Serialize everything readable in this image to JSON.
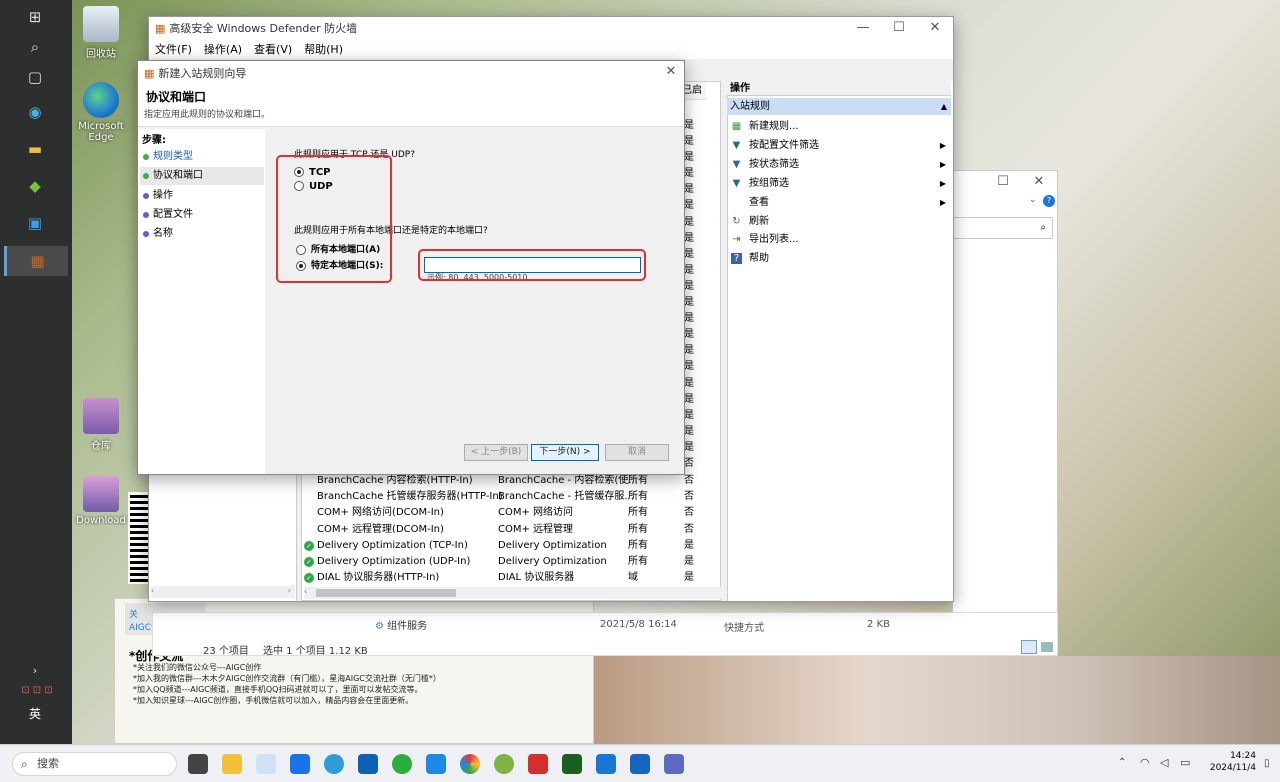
{
  "desktop": {
    "icons": [
      {
        "label": "回收站"
      },
      {
        "label": "Microsoft Edge"
      },
      {
        "label": "仓库"
      },
      {
        "label": "Download"
      }
    ]
  },
  "firewall": {
    "title": "高级安全 Windows Defender 防火墙",
    "menu": [
      "文件(F)",
      "操作(A)",
      "查看(V)",
      "帮助(H)"
    ],
    "col_partial": "已启用",
    "rows": [
      {
        "name": "BranchCache 内容检索(HTTP-In)",
        "group": "BranchCache - 内容检索(使...",
        "profile": "所有",
        "enabled": "否",
        "ok": false
      },
      {
        "name": "BranchCache 托管缓存服务器(HTTP-In)",
        "group": "BranchCache - 托管缓存服...",
        "profile": "所有",
        "enabled": "否",
        "ok": false
      },
      {
        "name": "COM+ 网络访问(DCOM-In)",
        "group": "COM+ 网络访问",
        "profile": "所有",
        "enabled": "否",
        "ok": false
      },
      {
        "name": "COM+ 远程管理(DCOM-In)",
        "group": "COM+ 远程管理",
        "profile": "所有",
        "enabled": "否",
        "ok": false
      },
      {
        "name": "Delivery Optimization (TCP-In)",
        "group": "Delivery Optimization",
        "profile": "所有",
        "enabled": "是",
        "ok": true
      },
      {
        "name": "Delivery Optimization (UDP-In)",
        "group": "Delivery Optimization",
        "profile": "所有",
        "enabled": "是",
        "ok": true
      },
      {
        "name": "DIAL 协议服务器(HTTP-In)",
        "group": "DIAL 协议服务器",
        "profile": "域",
        "enabled": "是",
        "ok": true
      }
    ],
    "enabled_col": [
      "是",
      "是",
      "是",
      "是",
      "是",
      "是",
      "是",
      "是",
      "是",
      "是",
      "是",
      "是",
      "是",
      "是",
      "是",
      "是",
      "是",
      "是",
      "是",
      "是",
      "是",
      "否"
    ],
    "actions": {
      "header": "操作",
      "section": "入站规则",
      "items": [
        {
          "label": "新建规则...",
          "icon": "new-rule-icon",
          "sub": false
        },
        {
          "label": "按配置文件筛选",
          "icon": "filter-icon",
          "sub": true
        },
        {
          "label": "按状态筛选",
          "icon": "filter-icon",
          "sub": true
        },
        {
          "label": "按组筛选",
          "icon": "filter-icon",
          "sub": true
        },
        {
          "label": "查看",
          "icon": "",
          "sub": true
        },
        {
          "label": "刷新",
          "icon": "refresh-icon",
          "sub": false
        },
        {
          "label": "导出列表...",
          "icon": "export-icon",
          "sub": false
        },
        {
          "label": "帮助",
          "icon": "help-icon",
          "sub": false
        }
      ]
    }
  },
  "explorer": {
    "file_name": "组件服务",
    "file_date": "2021/5/8 16:14",
    "file_type": "快捷方式",
    "file_size": "2 KB",
    "status_count": "23 个项目",
    "status_selected": "选中 1 个项目  1.12 KB"
  },
  "wizard": {
    "title": "新建入站规则向导",
    "heading": "协议和端口",
    "subheading": "指定应用此规则的协议和端口。",
    "steps_label": "步骤:",
    "steps": [
      {
        "label": "规则类型",
        "color": "#3cb043",
        "link": true
      },
      {
        "label": "协议和端口",
        "color": "#3cb043",
        "link": false
      },
      {
        "label": "操作",
        "color": "#6a5acd",
        "link": false
      },
      {
        "label": "配置文件",
        "color": "#6a5acd",
        "link": false
      },
      {
        "label": "名称",
        "color": "#6a5acd",
        "link": false
      }
    ],
    "q1": "此规则应用于 TCP 还是 UDP?",
    "tcp": "TCP",
    "udp": "UDP",
    "q2": "此规则应用于所有本地端口还是特定的本地端口?",
    "all_ports": "所有本地端口(A)",
    "specific_ports": "特定本地端口(S):",
    "port_value": "",
    "example": "示例: 80, 443, 5000-5010",
    "back": "< 上一步(B)",
    "next": "下一步(N) >",
    "cancel": "取消"
  },
  "notes": {
    "heading": "*创作交流",
    "lines": [
      "*关注我们的微信公众号---AIGC创作",
      "*加入我的微信群---木木夕AIGC创作交流群（有门槛），星海AIGC交流社群（无门槛*）",
      "*加入QQ频道---AIGC频道，直接手机QQ扫码进就可以了，里面可以发帖交流等。",
      "*加入知识星球---AIGC创作圈，手机微信就可以加入，精品内容会在里面更新。"
    ],
    "side": "关",
    "side2": "AIGC创作"
  },
  "taskbar": {
    "search": "搜索",
    "time": "14:24",
    "date": "2024/11/4",
    "ime": "英"
  }
}
